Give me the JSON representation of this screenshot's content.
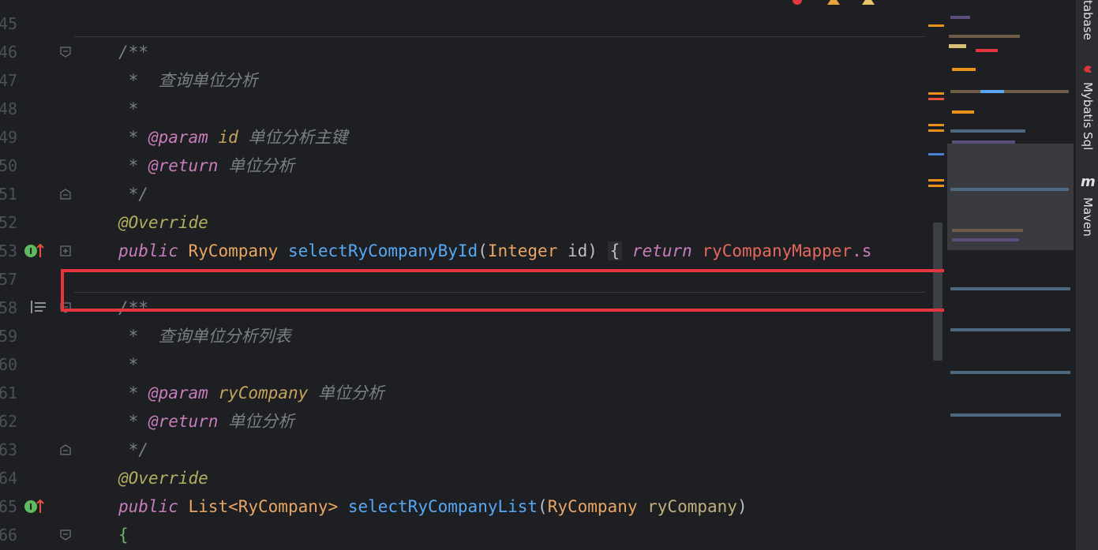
{
  "editor": {
    "lines": [
      {
        "num": "45",
        "text": ""
      },
      {
        "num": "46",
        "text": "/**"
      },
      {
        "num": "47",
        "text": " *  查询单位分析"
      },
      {
        "num": "48",
        "text": " *"
      },
      {
        "num": "49",
        "tag": "@param",
        "pname": "id",
        "desc": "单位分析主键"
      },
      {
        "num": "50",
        "tag": "@return",
        "desc": "单位分析"
      },
      {
        "num": "51",
        "text": " */"
      },
      {
        "num": "52",
        "annotation": "@Override"
      },
      {
        "num": "53",
        "code": {
          "mod": "public",
          "type": "RyCompany",
          "fn": "selectRyCompanyById",
          "open": "(",
          "ptype": "Integer",
          "pname": " id",
          "close": ")",
          "brace": "{",
          "ret": "return",
          "field": "ryCompanyMapper",
          "tail": ".s"
        }
      },
      {
        "num": "57",
        "text": ""
      },
      {
        "num": "58",
        "text": "/**"
      },
      {
        "num": "59",
        "text": " *  查询单位分析列表"
      },
      {
        "num": "60",
        "text": " *"
      },
      {
        "num": "61",
        "tag": "@param",
        "pname": "ryCompany",
        "desc": "单位分析"
      },
      {
        "num": "62",
        "tag": "@return",
        "desc": "单位分析"
      },
      {
        "num": "63",
        "text": " */"
      },
      {
        "num": "64",
        "annotation": "@Override"
      },
      {
        "num": "65",
        "code2": {
          "mod": "public",
          "type": "List",
          "generic": "<RyCompany>",
          "fn": "selectRyCompanyList",
          "open": "(",
          "ptype": "RyCompany",
          "pname": " ryCompany",
          "close": ")"
        }
      },
      {
        "num": "66",
        "text": "{"
      }
    ],
    "star_prefix": " * "
  },
  "toolstrip": {
    "database_label": "tabase",
    "mybatis_label": "Mybatis Sql",
    "maven_label": "Maven",
    "maven_glyph": "m"
  },
  "colors": {
    "highlight_box": "#e5363f",
    "background": "#1e1f22"
  }
}
